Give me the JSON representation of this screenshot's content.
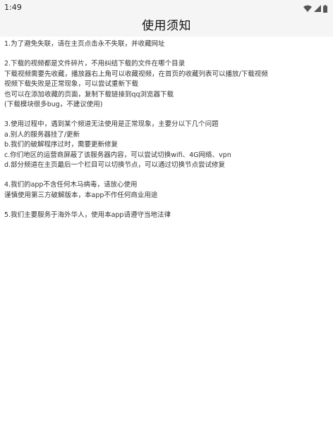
{
  "status_bar": {
    "time": "1:49",
    "icons": [
      "wifi-icon",
      "signal-icon",
      "battery-icon"
    ]
  },
  "header": {
    "title": "使用须知"
  },
  "sections": [
    {
      "lines": [
        "1.为了避免失联，请在主页点击永不失联，并收藏网址"
      ]
    },
    {
      "lines": [
        "2.下载的视频都是文件碎片，不用纠结下载的文件在哪个目录",
        "下载视频需要先收藏，播放器右上角可以收藏视频，在首页的收藏列表可以播放/下载视频",
        "视频下载失败是正常现象，可以尝试重新下载",
        "也可以在添加收藏的页面，复制下载链接到qq浏览器下载",
        "(下载模块很多bug，不建议使用)"
      ]
    },
    {
      "lines": [
        "3.使用过程中，遇到某个频道无法使用是正常现象，主要分以下几个问题",
        "a.别人的服务器挂了/更新",
        "b.我们的破解程序过时，需要更新修复",
        "c.你们地区的运营商屏蔽了该服务器内容，可以尝试切换wifi、4G网络、vpn",
        "d.部分频道在主页最后一个栏目可以切换节点，可以通过切换节点尝试修复"
      ]
    },
    {
      "lines": [
        "4.我们的app不含任何木马病毒，请放心使用",
        "谨慎使用第三方破解版本，本app不作任何商业用途"
      ]
    },
    {
      "lines": [
        "5.我们主要服务于海外华人，使用本app请遵守当地法律"
      ]
    }
  ]
}
